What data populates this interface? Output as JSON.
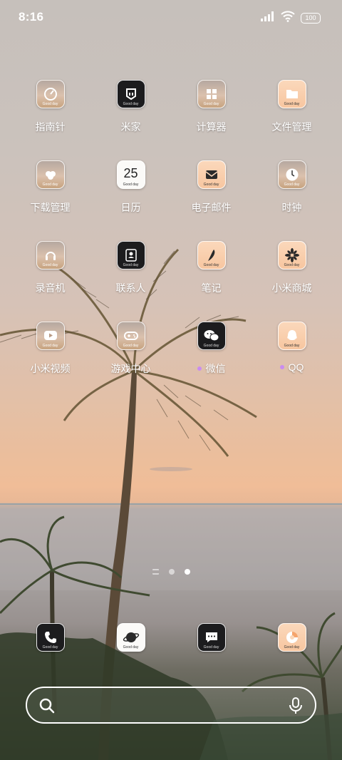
{
  "status_bar": {
    "time": "8:16",
    "battery": "100"
  },
  "icon_tag": "Good day",
  "apps": [
    {
      "label": "指南针",
      "icon": "compass-icon",
      "style": "photo"
    },
    {
      "label": "米家",
      "icon": "mijia-icon",
      "style": "dark"
    },
    {
      "label": "计算器",
      "icon": "calculator-icon",
      "style": "photo"
    },
    {
      "label": "文件管理",
      "icon": "folder-icon",
      "style": "peach"
    },
    {
      "label": "下载管理",
      "icon": "download-icon",
      "style": "photo"
    },
    {
      "label": "日历",
      "icon": "calendar-icon",
      "style": "white",
      "icon_text": "25"
    },
    {
      "label": "电子邮件",
      "icon": "mail-icon",
      "style": "peach"
    },
    {
      "label": "时钟",
      "icon": "clock-icon",
      "style": "photo"
    },
    {
      "label": "录音机",
      "icon": "recorder-icon",
      "style": "photo"
    },
    {
      "label": "联系人",
      "icon": "contacts-icon",
      "style": "dark"
    },
    {
      "label": "笔记",
      "icon": "notes-icon",
      "style": "peach"
    },
    {
      "label": "小米商城",
      "icon": "mi-store-icon",
      "style": "peach"
    },
    {
      "label": "小米视频",
      "icon": "video-icon",
      "style": "photo"
    },
    {
      "label": "游戏中心",
      "icon": "game-center-icon",
      "style": "photo"
    },
    {
      "label": "微信",
      "icon": "wechat-icon",
      "style": "dark",
      "new_dot": true
    },
    {
      "label": "QQ",
      "icon": "qq-icon",
      "style": "peach",
      "new_dot": true
    }
  ],
  "dock": [
    {
      "icon": "phone-icon",
      "style": "dark"
    },
    {
      "icon": "browser-icon",
      "style": "white"
    },
    {
      "icon": "messages-icon",
      "style": "dark"
    },
    {
      "icon": "themes-icon",
      "style": "peach"
    }
  ],
  "pager": {
    "pages": 3,
    "active": 2
  },
  "colors": {
    "accent_dot": "#c98cf0"
  }
}
